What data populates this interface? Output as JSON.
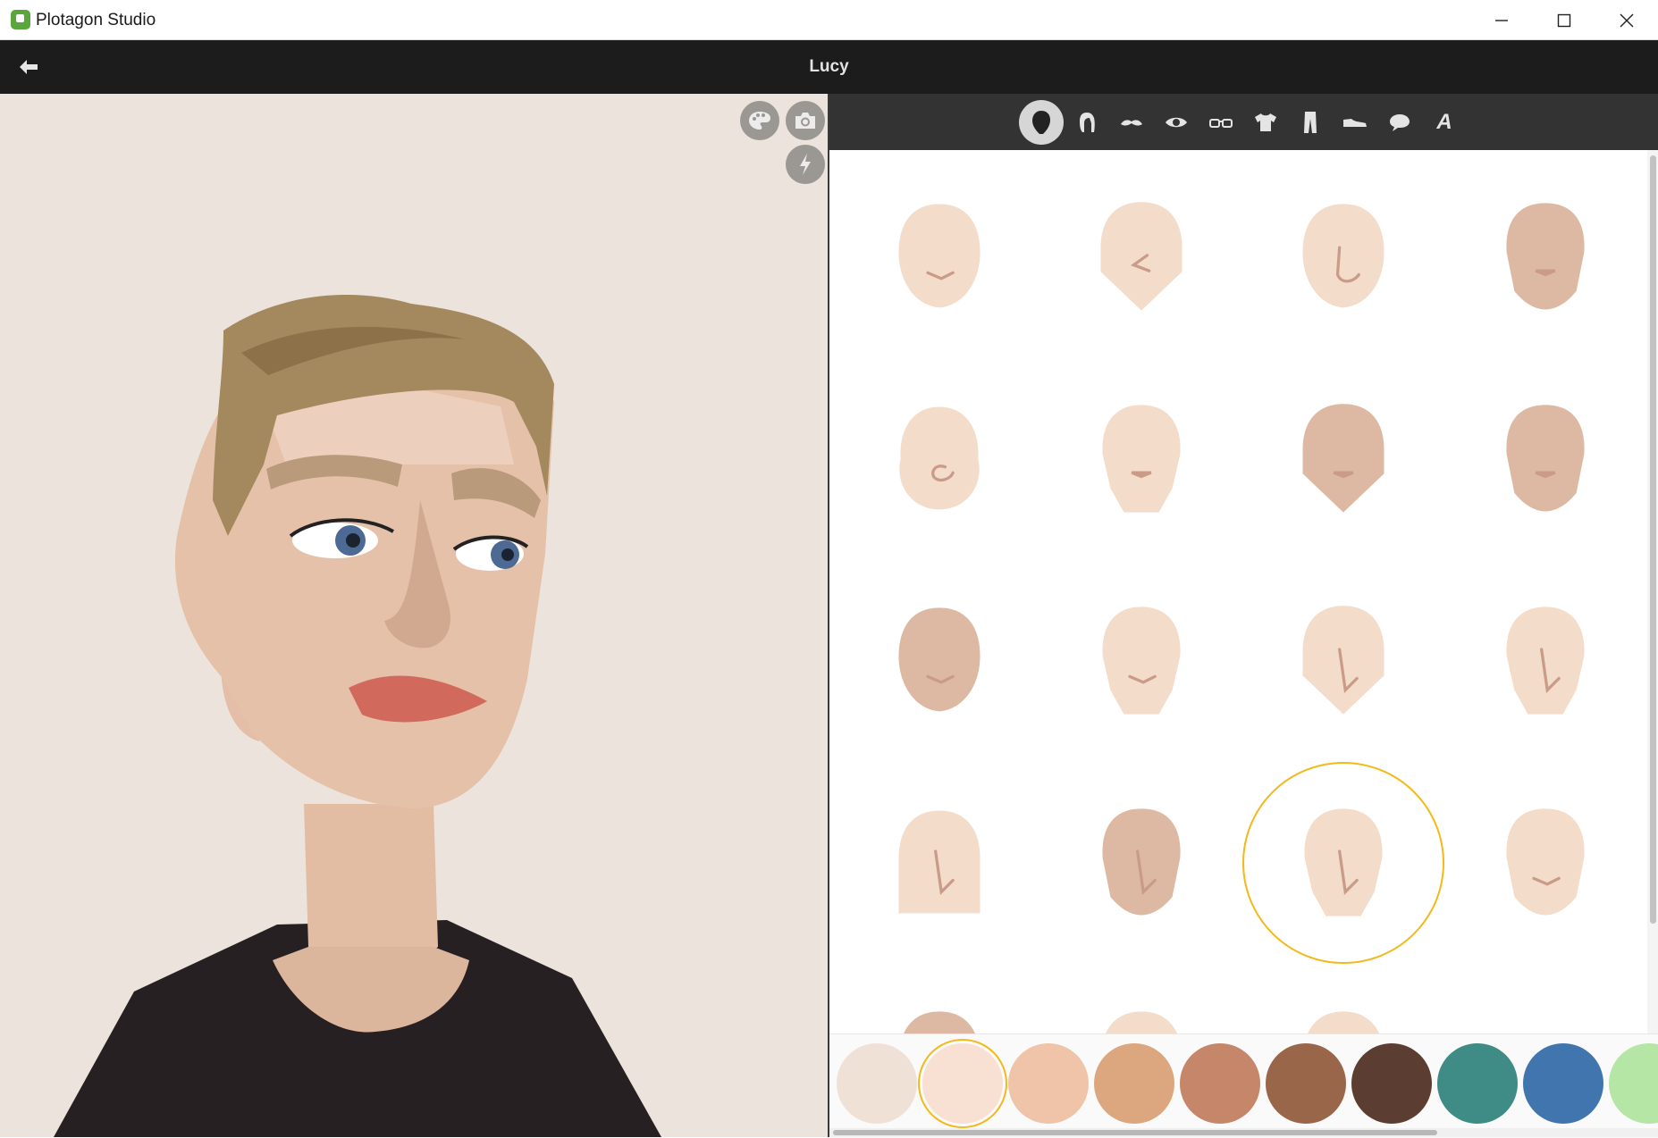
{
  "window": {
    "title": "Plotagon Studio"
  },
  "header": {
    "title": "Lucy"
  },
  "preview_buttons": [
    "palette-icon",
    "camera-icon",
    "randomize-icon"
  ],
  "tabs": [
    {
      "name": "head-shape-icon",
      "active": true
    },
    {
      "name": "hair-icon",
      "active": false
    },
    {
      "name": "mustache-icon",
      "active": false
    },
    {
      "name": "eye-icon",
      "active": false
    },
    {
      "name": "glasses-icon",
      "active": false
    },
    {
      "name": "shirt-icon",
      "active": false
    },
    {
      "name": "pants-icon",
      "active": false
    },
    {
      "name": "shoe-icon",
      "active": false
    },
    {
      "name": "speech-bubble-icon",
      "active": false
    },
    {
      "name": "text-a-icon",
      "active": false
    }
  ],
  "tab_text_a": "A",
  "faces": {
    "tones": [
      "#f3dcca",
      "#ddb9a3"
    ],
    "rows": [
      [
        {
          "shape": "round",
          "tone": 0,
          "nose": "smile"
        },
        {
          "shape": "pointed",
          "tone": 0,
          "nose": "angle"
        },
        {
          "shape": "round",
          "tone": 0,
          "nose": "hook"
        },
        {
          "shape": "jaw",
          "tone": 1,
          "nose": "dash"
        }
      ],
      [
        {
          "shape": "wide",
          "tone": 0,
          "nose": "curl"
        },
        {
          "shape": "narrow",
          "tone": 0,
          "nose": "dash"
        },
        {
          "shape": "pointed",
          "tone": 1,
          "nose": "dash"
        },
        {
          "shape": "jaw",
          "tone": 1,
          "nose": "dash"
        }
      ],
      [
        {
          "shape": "round",
          "tone": 1,
          "nose": "smile"
        },
        {
          "shape": "narrow",
          "tone": 0,
          "nose": "smile"
        },
        {
          "shape": "pointed",
          "tone": 0,
          "nose": "long"
        },
        {
          "shape": "narrow",
          "tone": 0,
          "nose": "long"
        }
      ],
      [
        {
          "shape": "square",
          "tone": 0,
          "nose": "long"
        },
        {
          "shape": "jaw",
          "tone": 1,
          "nose": "long"
        },
        {
          "shape": "narrow",
          "tone": 0,
          "nose": "long",
          "selected": true
        },
        {
          "shape": "jaw",
          "tone": 0,
          "nose": "smile"
        }
      ],
      [
        {
          "shape": "round",
          "tone": 1,
          "nose": "dash"
        },
        {
          "shape": "round",
          "tone": 0,
          "nose": "dash"
        },
        {
          "shape": "round",
          "tone": 0,
          "nose": "dash"
        }
      ]
    ]
  },
  "skin_colors": [
    "#f0e1d6",
    "#f8e0d3",
    "#f0c4a8",
    "#dca77e",
    "#c6866a",
    "#9a6649",
    "#5b3e31",
    "#3f8c86",
    "#4075ad",
    "#b6e6a6"
  ],
  "selected_color_index": 1
}
